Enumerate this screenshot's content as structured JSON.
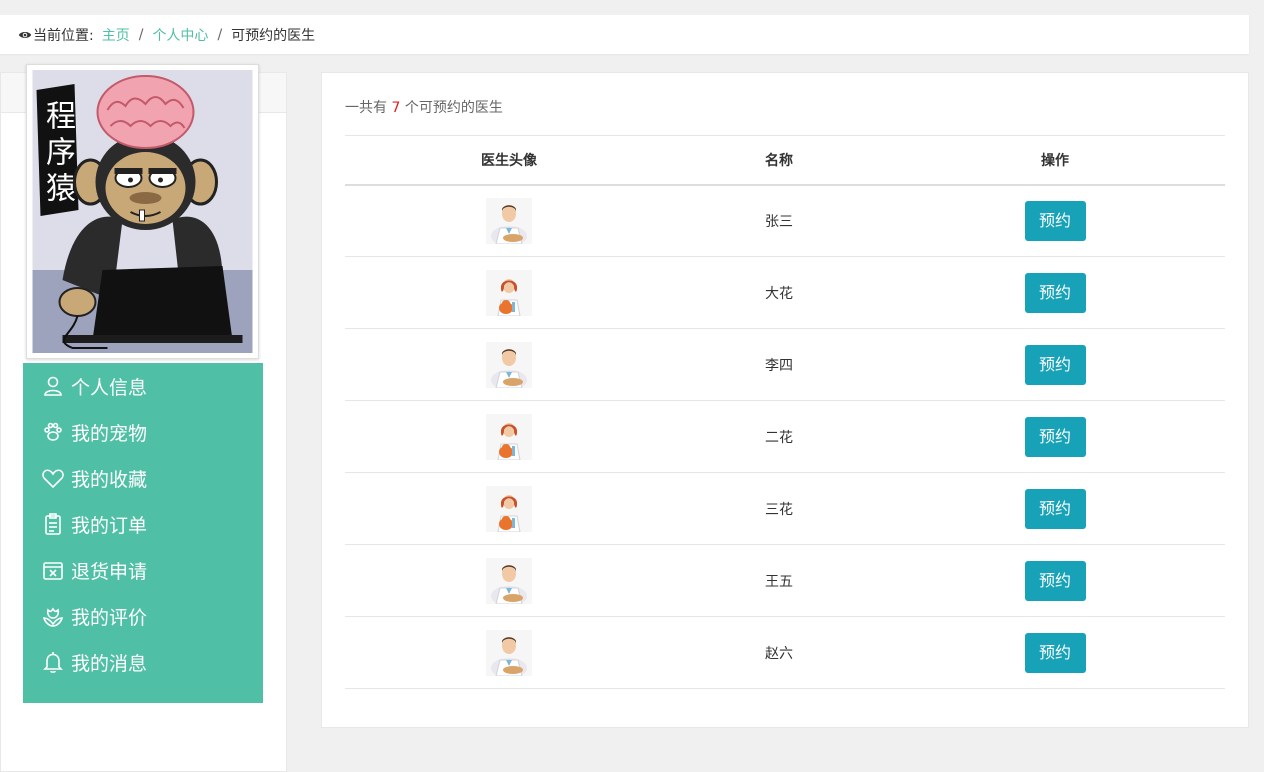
{
  "breadcrumb": {
    "prefix": "当前位置:",
    "home": "主页",
    "center": "个人中心",
    "current": "可预约的医生"
  },
  "sidebar": {
    "avatar_text": "程序猿",
    "menu": [
      {
        "label": "个人信息",
        "icon": "user-icon"
      },
      {
        "label": "我的宠物",
        "icon": "paw-icon"
      },
      {
        "label": "我的收藏",
        "icon": "heart-icon"
      },
      {
        "label": "我的订单",
        "icon": "clipboard-icon"
      },
      {
        "label": "退货申请",
        "icon": "return-box-icon"
      },
      {
        "label": "我的评价",
        "icon": "flower-icon"
      },
      {
        "label": "我的消息",
        "icon": "bell-icon"
      }
    ]
  },
  "main": {
    "summary_prefix": "一共有",
    "summary_count": "7",
    "summary_suffix": "个可预约的医生",
    "columns": [
      "医生头像",
      "名称",
      "操作"
    ],
    "rows": [
      {
        "name": "张三",
        "avatar": "male-doctor",
        "action": "预约"
      },
      {
        "name": "大花",
        "avatar": "female-doctor",
        "action": "预约"
      },
      {
        "name": "李四",
        "avatar": "male-doctor",
        "action": "预约"
      },
      {
        "name": "二花",
        "avatar": "female-doctor",
        "action": "预约"
      },
      {
        "name": "三花",
        "avatar": "female-doctor",
        "action": "预约"
      },
      {
        "name": "王五",
        "avatar": "male-doctor",
        "action": "预约"
      },
      {
        "name": "赵六",
        "avatar": "male-doctor",
        "action": "预约"
      }
    ]
  },
  "colors": {
    "accent": "#4fbfa5",
    "button": "#17a2b8",
    "count": "#e02020"
  }
}
